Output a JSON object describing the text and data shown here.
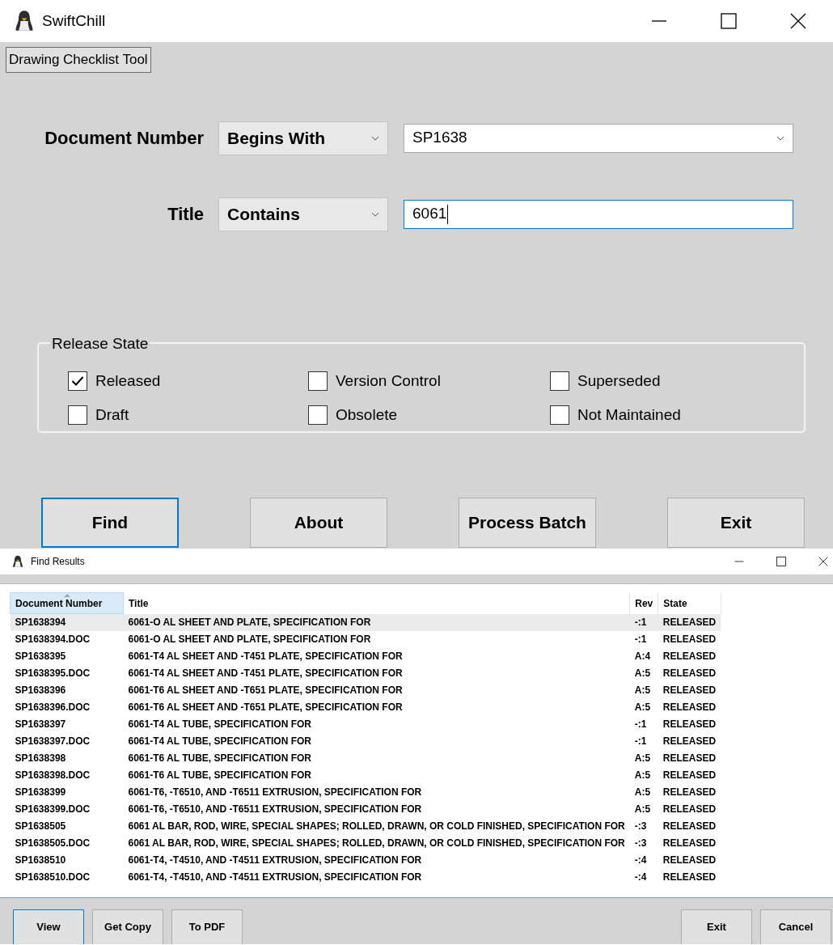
{
  "main_window": {
    "title": "SwiftChill",
    "tab_label": "Drawing Checklist Tool",
    "filters": [
      {
        "label": "Document Number",
        "operator": "Begins With",
        "kind": "combo",
        "value": "SP1638",
        "focused": false
      },
      {
        "label": "Title",
        "operator": "Contains",
        "kind": "text",
        "value": "6061",
        "focused": true
      }
    ],
    "release_state": {
      "title": "Release State",
      "options": [
        {
          "label": "Released",
          "checked": true
        },
        {
          "label": "Version Control",
          "checked": false
        },
        {
          "label": "Superseded",
          "checked": false
        },
        {
          "label": "Draft",
          "checked": false
        },
        {
          "label": "Obsolete",
          "checked": false
        },
        {
          "label": "Not Maintained",
          "checked": false
        }
      ]
    },
    "buttons": [
      {
        "label": "Find",
        "default": true
      },
      {
        "label": "About",
        "default": false
      },
      {
        "label": "Process Batch",
        "default": false
      },
      {
        "label": "Exit",
        "default": false
      }
    ]
  },
  "results_window": {
    "title": "Find Results",
    "columns": [
      {
        "label": "Document Number",
        "sorted": true
      },
      {
        "label": "Title",
        "sorted": false
      },
      {
        "label": "Rev",
        "sorted": false
      },
      {
        "label": "State",
        "sorted": false
      }
    ],
    "rows": [
      {
        "cells": [
          "SP1638394",
          "6061-O AL SHEET AND PLATE, SPECIFICATION FOR",
          "-:1",
          "RELEASED"
        ],
        "selected": true
      },
      {
        "cells": [
          "SP1638394.DOC",
          "6061-O AL SHEET AND PLATE, SPECIFICATION FOR",
          "-:1",
          "RELEASED"
        ],
        "selected": false
      },
      {
        "cells": [
          "SP1638395",
          "6061-T4 AL SHEET AND -T451 PLATE, SPECIFICATION FOR",
          "A:4",
          "RELEASED"
        ],
        "selected": false
      },
      {
        "cells": [
          "SP1638395.DOC",
          "6061-T4 AL SHEET AND -T451 PLATE, SPECIFICATION FOR",
          "A:5",
          "RELEASED"
        ],
        "selected": false
      },
      {
        "cells": [
          "SP1638396",
          "6061-T6 AL SHEET AND -T651 PLATE, SPECIFICATION FOR",
          "A:5",
          "RELEASED"
        ],
        "selected": false
      },
      {
        "cells": [
          "SP1638396.DOC",
          "6061-T6 AL SHEET AND -T651 PLATE, SPECIFICATION FOR",
          "A:5",
          "RELEASED"
        ],
        "selected": false
      },
      {
        "cells": [
          "SP1638397",
          "6061-T4 AL TUBE, SPECIFICATION FOR",
          "-:1",
          "RELEASED"
        ],
        "selected": false
      },
      {
        "cells": [
          "SP1638397.DOC",
          "6061-T4 AL TUBE, SPECIFICATION FOR",
          "-:1",
          "RELEASED"
        ],
        "selected": false
      },
      {
        "cells": [
          "SP1638398",
          "6061-T6 AL TUBE, SPECIFICATION FOR",
          "A:5",
          "RELEASED"
        ],
        "selected": false
      },
      {
        "cells": [
          "SP1638398.DOC",
          "6061-T6 AL TUBE, SPECIFICATION FOR",
          "A:5",
          "RELEASED"
        ],
        "selected": false
      },
      {
        "cells": [
          "SP1638399",
          "6061-T6, -T6510, AND -T6511 EXTRUSION, SPECIFICATION FOR",
          "A:5",
          "RELEASED"
        ],
        "selected": false
      },
      {
        "cells": [
          "SP1638399.DOC",
          "6061-T6, -T6510, AND -T6511 EXTRUSION, SPECIFICATION FOR",
          "A:5",
          "RELEASED"
        ],
        "selected": false
      },
      {
        "cells": [
          "SP1638505",
          "6061 AL BAR, ROD, WIRE, SPECIAL SHAPES; ROLLED, DRAWN, OR COLD FINISHED, SPECIFICATION FOR",
          "-:3",
          "RELEASED"
        ],
        "selected": false
      },
      {
        "cells": [
          "SP1638505.DOC",
          "6061 AL BAR, ROD, WIRE, SPECIAL SHAPES; ROLLED, DRAWN, OR COLD FINISHED, SPECIFICATION FOR",
          "-:3",
          "RELEASED"
        ],
        "selected": false
      },
      {
        "cells": [
          "SP1638510",
          "6061-T4, -T4510, AND -T4511 EXTRUSION, SPECIFICATION FOR",
          "-:4",
          "RELEASED"
        ],
        "selected": false
      },
      {
        "cells": [
          "SP1638510.DOC",
          "6061-T4, -T4510, AND -T4511 EXTRUSION, SPECIFICATION FOR",
          "-:4",
          "RELEASED"
        ],
        "selected": false
      }
    ],
    "left_buttons": [
      {
        "label": "View",
        "default": true
      },
      {
        "label": "Get Copy",
        "default": false
      },
      {
        "label": "To PDF",
        "default": false
      }
    ],
    "right_buttons": [
      {
        "label": "Exit",
        "default": false
      },
      {
        "label": "Cancel",
        "default": false
      }
    ]
  }
}
